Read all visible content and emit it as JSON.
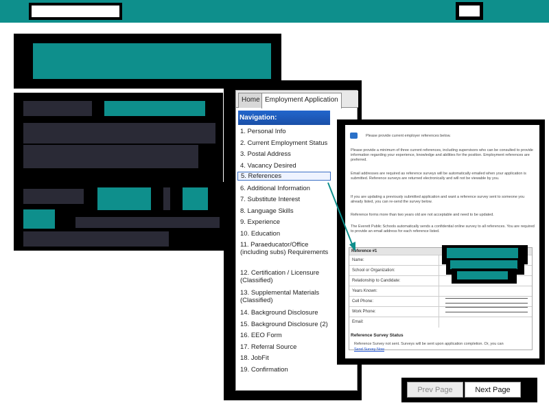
{
  "tabs": {
    "home": "Home",
    "employment_application": "Employment Application"
  },
  "navigation": {
    "header": "Navigation:",
    "items": [
      "1. Personal Info",
      "2. Current Employment Status",
      "3. Postal Address",
      "4. Vacancy Desired",
      "5. References",
      "6. Additional Information",
      "7. Substitute Interest",
      "8. Language Skills",
      "9. Experience",
      "10. Education",
      "11. Paraeducator/Office (including subs) Requirements",
      "12. Certification / Licensure (Classified)",
      "13. Supplemental Materials (Classified)",
      "14. Background Disclosure",
      "15. Background Disclosure (2)",
      "16. EEO Form",
      "17. Referral Source",
      "18. JobFit",
      "19. Confirmation"
    ]
  },
  "form": {
    "intro": "Please provide current employer references below.",
    "para1": "Please provide a minimum of three current references, including supervisors who can be consulted to provide information regarding your experience, knowledge and abilities for the position. Employment references are preferred.",
    "para2": "Email addresses are required as reference surveys will be automatically emailed when your application is submitted. Reference surveys are returned electronically and will not be viewable by you.",
    "para3": "If you are updating a previously submitted application and want a reference survey sent to someone you already listed, you can re-send the survey below.",
    "para4": "Reference forms more than two years old are not acceptable and need to be updated.",
    "para5": "The Everett Public Schools automatically sends a confidential online survey to all references. You are required to provide an email address for each reference listed.",
    "reference_header": "Reference #1",
    "fields": [
      "Name:",
      "School or Organization:",
      "Relationship to Candidate:",
      "Years Known:",
      "Cell Phone:",
      "Work Phone:",
      "Email:"
    ],
    "survey_title": "Reference Survey Status",
    "survey_text": "Reference Survey not sent. Surveys will be sent upon application completion. Or, you can",
    "survey_link": "Send Survey Now"
  },
  "pager": {
    "prev": "Prev Page",
    "next": "Next Page"
  },
  "colors": {
    "teal": "#0e8f8c",
    "dark": "#2a2a36",
    "nav_blue": "#1a4fa8"
  }
}
